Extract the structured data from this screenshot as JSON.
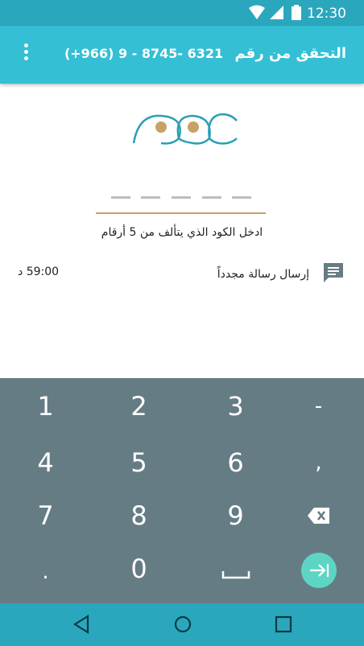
{
  "status_bar": {
    "time": "12:30",
    "icons": [
      "wifi-icon",
      "cellular-signal-icon",
      "battery-icon"
    ]
  },
  "app_bar": {
    "title": "التحقق من رقم",
    "phone_number": "(+966) 9 - 8745- 6321",
    "menu_icon": "overflow-menu-icon"
  },
  "verification": {
    "code_length": 5,
    "hint": "ادخل الكود الذي يتألف من 5 أرقام",
    "resend_label": "إرسال رسالة مجدداً",
    "timer": "59:00 د"
  },
  "keypad": {
    "rows": [
      [
        "1",
        "2",
        "3",
        "-"
      ],
      [
        "4",
        "5",
        "6",
        ","
      ],
      [
        "7",
        "8",
        "9",
        "backspace"
      ],
      [
        ".",
        "0",
        "space",
        "go"
      ]
    ]
  },
  "nav_bar": {
    "buttons": [
      "back-icon",
      "home-icon",
      "recents-icon"
    ]
  },
  "colors": {
    "status_bar": "#2aa7bd",
    "app_bar": "#34bfd4",
    "keypad": "#667c84",
    "accent_gold": "#c8a164",
    "go_button": "#5ed5c4"
  }
}
